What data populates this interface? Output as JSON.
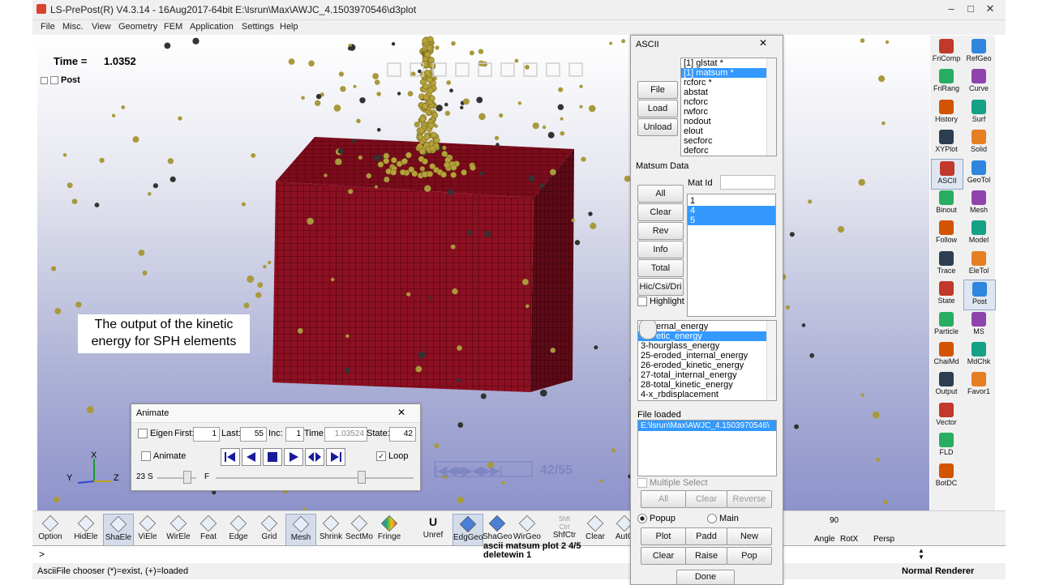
{
  "window": {
    "title": "LS-PrePost(R) V4.3.14 - 16Aug2017-64bit E:\\lsrun\\Max\\AWJC_4.1503970546\\d3plot",
    "minimize": "–",
    "maximize": "□",
    "close": "✕"
  },
  "menu": [
    "File",
    "Misc.",
    "View",
    "Geometry",
    "FEM",
    "Application",
    "Settings",
    "Help"
  ],
  "viewport": {
    "time_label": "Time =",
    "time_value": "1.0352",
    "tree_item": "Post",
    "annotation_line1": "The output of the kinetic",
    "annotation_line2": "energy for SPH elements",
    "axis_x": "X",
    "axis_y": "Y",
    "axis_z": "Z",
    "frame_counter": "42/55",
    "colors": {
      "block": "#8c1022",
      "mesh": "#3d0008",
      "particle": "#a89a3c",
      "sph": "#b5a23a"
    }
  },
  "right_tools": [
    [
      "FriComp",
      "RefGeo"
    ],
    [
      "FriRang",
      "Curve"
    ],
    [
      "History",
      "Surf"
    ],
    [
      "XYPlot",
      "Solid"
    ],
    [
      "ASCII",
      "GeoTol"
    ],
    [
      "Binout",
      "Mesh"
    ],
    [
      "Follow",
      "Model"
    ],
    [
      "Trace",
      "EleTol"
    ],
    [
      "State",
      "Post"
    ],
    [
      "Particle",
      "MS"
    ],
    [
      "ChaiMd",
      "MdChk"
    ],
    [
      "Output",
      "Favor1"
    ],
    [
      "Vector",
      ""
    ],
    [
      "FLD",
      ""
    ],
    [
      "BotDC",
      ""
    ]
  ],
  "bottom_tools": [
    "Option",
    "HidEle",
    "ShaEle",
    "ViEle",
    "WirEle",
    "Feat",
    "Edge",
    "Grid",
    "Mesh",
    "Shrink",
    "SectMo",
    "Fringe",
    "Unref",
    "EdgGeo",
    "ShaGeo",
    "WirGeo",
    "ShfCtr",
    "Clear",
    "AutC"
  ],
  "bottom_right_tools": {
    "angle_value": "90",
    "angle": "Angle",
    "rotx": "RotX",
    "persp": "Persp"
  },
  "shfctrl_icon_text": [
    "Shft",
    "Ctrl"
  ],
  "unref_icon_text": "U",
  "cmd_prompt": ">",
  "cmd_history": [
    "ascii matsum plot 2 4/5",
    "deletewin 1"
  ],
  "status_left": "AsciiFile chooser (*)=exist, (+)=loaded",
  "status_right": "Normal Renderer",
  "ascii_panel": {
    "title": "ASCII",
    "file_buttons": [
      "File",
      "Load",
      "Unload"
    ],
    "files": [
      {
        "label": "[1] glstat *",
        "selected": false
      },
      {
        "label": "[1] matsum *",
        "selected": true
      },
      {
        "label": "rcforc *",
        "selected": false
      },
      {
        "label": "abstat",
        "selected": false
      },
      {
        "label": "ncforc",
        "selected": false
      },
      {
        "label": "rwforc",
        "selected": false
      },
      {
        "label": "nodout",
        "selected": false
      },
      {
        "label": "elout",
        "selected": false
      },
      {
        "label": "secforc",
        "selected": false
      },
      {
        "label": "deforc",
        "selected": false
      }
    ],
    "data_title": "Matsum Data",
    "mat_id_label": "Mat Id",
    "mat_id_value": "",
    "data_buttons": [
      "All",
      "Clear",
      "Rev",
      "Info",
      "Total",
      "Hic/Csi/Dri"
    ],
    "highlight_label": "Highlight",
    "mat_ids": [
      {
        "label": "1",
        "selected": false
      },
      {
        "label": "4",
        "selected": true
      },
      {
        "label": "5",
        "selected": true
      }
    ],
    "components": [
      {
        "label": "ernal_energy",
        "selected": false
      },
      {
        "label": "etic_energy",
        "selected": true
      },
      {
        "label": "3-hourglass_energy",
        "selected": false
      },
      {
        "label": "25-eroded_internal_energy",
        "selected": false
      },
      {
        "label": "26-eroded_kinetic_energy",
        "selected": false
      },
      {
        "label": "27-total_internal_energy",
        "selected": false
      },
      {
        "label": "28-total_kinetic_energy",
        "selected": false
      },
      {
        "label": "4-x_rbdisplacement",
        "selected": false
      }
    ],
    "file_loaded_label": "File loaded",
    "file_loaded_value": "E:\\lsrun\\Max\\AWJC_4.1503970546\\",
    "multiple_select_label": "Multiple Select",
    "multi_buttons": [
      "All",
      "Clear",
      "Reverse"
    ],
    "popup_label": "Popup",
    "main_label": "Main",
    "action_buttons": [
      "Plot",
      "Padd",
      "New",
      "Clear",
      "Raise",
      "Pop"
    ],
    "done_label": "Done"
  },
  "animate": {
    "title": "Animate",
    "eigen_label": "Eigen",
    "first_label": "First:",
    "first_value": "1",
    "last_label": "Last:",
    "last_value": "55",
    "inc_label": "Inc:",
    "inc_value": "1",
    "time_label": "Time:",
    "time_value": "1.03524",
    "state_label": "State:",
    "state_value": "42",
    "animate_label": "Animate",
    "loop_label": "Loop",
    "speed_value": "23",
    "speed_s": "S",
    "speed_f": "F"
  }
}
